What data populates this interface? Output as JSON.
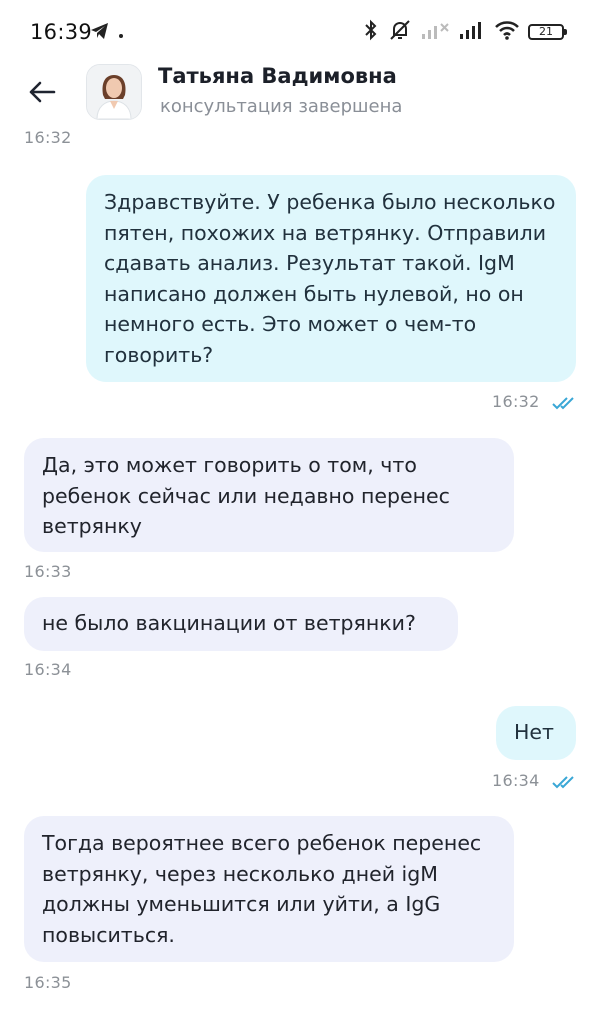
{
  "status_bar": {
    "time": "16:39",
    "battery": "21"
  },
  "header": {
    "name": "Татьяна Вадимовна",
    "status": "консультация завершена"
  },
  "chat": {
    "top_cut_time": "16:32",
    "messages": [
      {
        "direction": "outgoing",
        "text": "Здравствуйте. У ребенка было несколько пятен, похожих на ветрянку. Отправили сдавать анализ. Результат такой. IgM написано должен быть нулевой, но он немного есть. Это может о чем-то говорить?",
        "time": "16:32",
        "read": true
      },
      {
        "direction": "incoming",
        "text": "Да, это может говорить о том, что ребенок сейчас или недавно перенес ветрянку",
        "time": "16:33"
      },
      {
        "direction": "incoming",
        "text": "не было вакцинации от ветрянки?",
        "time": "16:34"
      },
      {
        "direction": "outgoing",
        "text": "Нет",
        "time": "16:34",
        "read": true
      },
      {
        "direction": "incoming",
        "text": "Тогда вероятнее всего ребенок перенес ветрянку, через несколько дней igM должны уменьшится или уйти, а IgG повыситься.",
        "time": "16:35"
      }
    ]
  },
  "colors": {
    "outgoing_bubble": "#dff7fc",
    "incoming_bubble": "#eef0fb",
    "read_check": "#3aa7d6"
  }
}
